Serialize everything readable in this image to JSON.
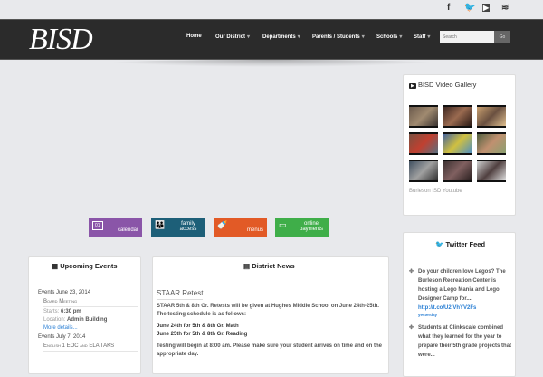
{
  "social": [
    "facebook-icon",
    "twitter-icon",
    "youtube-icon",
    "rss-icon"
  ],
  "logo": "BISD",
  "nav": {
    "items": [
      "Home",
      "Our District",
      "Departments",
      "Parents / Students",
      "Schools",
      "Staff"
    ],
    "search_placeholder": "Search",
    "go": "Go"
  },
  "video": {
    "title": "BISD Video Gallery",
    "link": "Burleson ISD Youtube"
  },
  "quick": [
    {
      "label": "calendar",
      "num": "01",
      "color": "#8a55a8"
    },
    {
      "label": "family access",
      "color": "#1d5f78"
    },
    {
      "label": "menus",
      "color": "#e25a26"
    },
    {
      "label": "online payments",
      "color": "#3fae49"
    }
  ],
  "events": {
    "title": "Upcoming Events",
    "groups": [
      {
        "date": "Events June 23, 2014",
        "name": "Board Meeting",
        "starts_label": "Starts:",
        "starts": "6:30 pm",
        "loc_label": "Location:",
        "loc": "Admin Building",
        "more": "More details..."
      },
      {
        "date": "Events July 7, 2014",
        "name": "English 1 EOC and ELA TAKS"
      }
    ]
  },
  "news": {
    "title": "District News",
    "headline": "STAAR Retest",
    "p1": "STAAR 5th & 8th Gr. Retests will be given at Hughes Middle School on June 24th-25th. The testing schedule is as follows:",
    "l1": "June 24th for 5th & 8th Gr. Math",
    "l2": "June 25th for 5th & 8th Gr. Reading",
    "p2": "Testing will begin at 8:00 am. Please make sure your student arrives on time and on the appropriate day."
  },
  "twitter": {
    "title": "Twitter Feed",
    "tweets": [
      {
        "text": "Do your children love Legos? The Burleson Recreation Center is hosting a Lego Mania and Lego Designer Camp for....",
        "link": "http://t.co/U2lVhYV2Fs",
        "time": "yesterday"
      },
      {
        "text": "Students at Clinkscale combined what they learned for the year to prepare their 5th grade projects that were..."
      }
    ]
  }
}
